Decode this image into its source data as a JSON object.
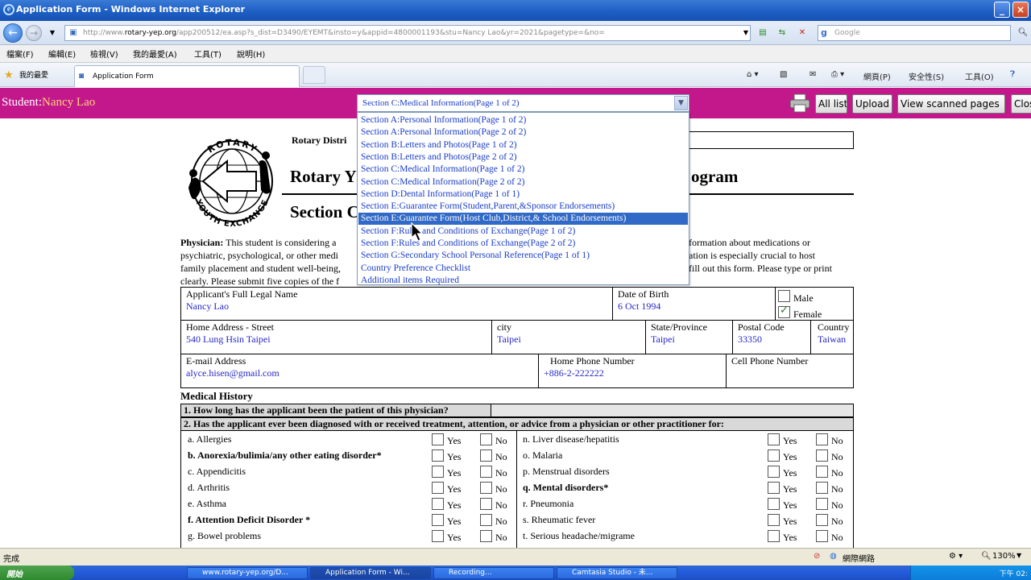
{
  "window": {
    "title": "Application Form - Windows Internet Explorer",
    "min_icon": "minimize-icon",
    "max_icon": "restore-icon",
    "close_icon": "close-icon"
  },
  "browser": {
    "address_prefix": "http://www.",
    "address_host": "rotary-yep.org",
    "address_rest": "/app200512/ea.asp?s_dist=D3490/EYEMT&insto=y&appid=4800001193&stu=Nancy Lao&yr=2021&pagetype=&no=",
    "search_placeholder": "Google",
    "menu": [
      "檔案(F)",
      "編輯(E)",
      "檢視(V)",
      "我的最愛(A)",
      "工具(T)",
      "說明(H)"
    ],
    "favorites_label": "我的最愛",
    "tab_label": "Application Form",
    "commands": {
      "page": "網頁(P)",
      "safety": "安全性(S)",
      "tools": "工具(O)"
    }
  },
  "header": {
    "student_prefix": "Student:",
    "student_name": "Nancy Lao",
    "selected_section": "Section C:Medical Information(Page 1 of 2)",
    "buttons": {
      "all_list": "All list",
      "upload": "Upload",
      "view_scanned": "View scanned pages",
      "close": "Close"
    }
  },
  "dropdown": {
    "options": [
      "Section A:Personal Information(Page 1 of 2)",
      "Section A:Personal Information(Page 2 of 2)",
      "Section B:Letters and Photos(Page 1 of 2)",
      "Section B:Letters and Photos(Page 2 of 2)",
      "Section C:Medical Information(Page 1 of 2)",
      "Section C:Medical Information(Page 2 of 2)",
      "Section D:Dental Information(Page 1 of 1)",
      "Section E:Guarantee Form(Student,Parent,&Sponsor Endorsements)",
      "Section E:Guarantee Form(Host Club,District,& School Endorsements)",
      "Section F:Rules and Conditions of Exchange(Page 1 of 2)",
      "Section F:Rules and Conditions of Exchange(Page 2 of 2)",
      "Section G:Secondary School Personal Reference(Page 1 of 1)",
      "Country Preference Checklist",
      "Additional items Required"
    ],
    "highlighted_index": 8
  },
  "form": {
    "logo_text_top": "ROTARY",
    "logo_text_bottom": "YOUTH EXCHANGE",
    "district": "Rotary Distri",
    "heading_left": "Rotary Y",
    "heading_right": "ogram",
    "section_heading": "Section C",
    "physician_label": "Physician:",
    "para_lines_left": [
      " This student is considering a",
      "psychiatric, psychological, or other medi",
      "family placement and student well-being,",
      "clearly. Please submit five copies of the f"
    ],
    "para_lines_right": [
      "formation about medications or",
      "ation is especially crucial to host",
      " fill out this form. Please type or print",
      ""
    ],
    "fields": {
      "full_name_label": "Applicant's Full Legal Name",
      "full_name": "Nancy Lao",
      "dob_label": "Date of Birth",
      "dob": "6 Oct 1994",
      "male_label": "Male",
      "female_label": "Female",
      "street_label": "Home Address - Street",
      "street": "540 Lung Hsin Taipei",
      "city_label": "city",
      "city": "Taipei",
      "state_label": "State/Province",
      "state": "Taipei",
      "postal_label": "Postal Code",
      "postal": "33350",
      "country_label": "Country",
      "country": "Taiwan",
      "email_label": "E-mail Address",
      "email": "alyce.hisen@gmail.com",
      "home_phone_label": "Home Phone Number",
      "home_phone": "+886-2-222222",
      "cell_phone_label": "Cell Phone Number",
      "cell_phone": ""
    },
    "medical_history_title": "Medical History",
    "question1": "1. How long has the applicant been the patient of this physician?",
    "question2": "2. Has the applicant ever been diagnosed with or received treatment, attention, or advice from a physician or other practitioner for:",
    "yes_label": "Yes",
    "no_label": "No",
    "conditions_left": [
      {
        "text": "a. Allergies",
        "bold": false
      },
      {
        "text": "b. Anorexia/bulimia/any other eating disorder*",
        "bold": true
      },
      {
        "text": "c. Appendicitis",
        "bold": false
      },
      {
        "text": "d. Arthritis",
        "bold": false
      },
      {
        "text": "e. Asthma",
        "bold": false
      },
      {
        "text": "f. Attention Deficit Disorder *",
        "bold": true
      },
      {
        "text": "g. Bowel problems",
        "bold": false
      }
    ],
    "conditions_right": [
      {
        "text": "n. Liver disease/hepatitis",
        "bold": false
      },
      {
        "text": "o. Malaria",
        "bold": false
      },
      {
        "text": "p. Menstrual disorders",
        "bold": false
      },
      {
        "text": "q. Mental disorders*",
        "bold": true
      },
      {
        "text": "r. Pneumonia",
        "bold": false
      },
      {
        "text": "s. Rheumatic fever",
        "bold": false
      },
      {
        "text": "t. Serious headache/migrame",
        "bold": false
      }
    ]
  },
  "statusbar": {
    "left": "完成",
    "zone": "網際網路",
    "zoom": "130%"
  },
  "taskbar": {
    "start": "開始",
    "tasks": [
      "www.rotary-yep.org/D...",
      "Application Form - Wi...",
      "Recording...",
      "Camtasia Studio - 未..."
    ],
    "clock": "下午 02:"
  },
  "colors": {
    "student_bar": "#c2188b",
    "student_name": "#ffd37a",
    "link_blue": "#1a3dc9",
    "value_blue": "#2727c7",
    "highlight": "#3169c6"
  }
}
